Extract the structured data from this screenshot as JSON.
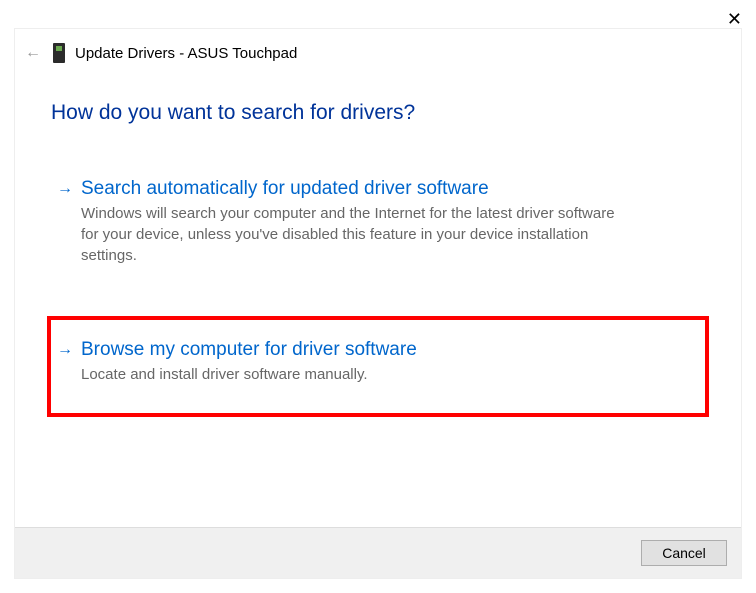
{
  "window": {
    "title_prefix": "Update Drivers",
    "device_name": "ASUS Touchpad",
    "full_title": "Update Drivers - ASUS Touchpad"
  },
  "heading": "How do you want to search for drivers?",
  "options": [
    {
      "title": "Search automatically for updated driver software",
      "description": "Windows will search your computer and the Internet for the latest driver software for your device, unless you've disabled this feature in your device installation settings."
    },
    {
      "title": "Browse my computer for driver software",
      "description": "Locate and install driver software manually."
    }
  ],
  "footer": {
    "cancel_label": "Cancel"
  }
}
